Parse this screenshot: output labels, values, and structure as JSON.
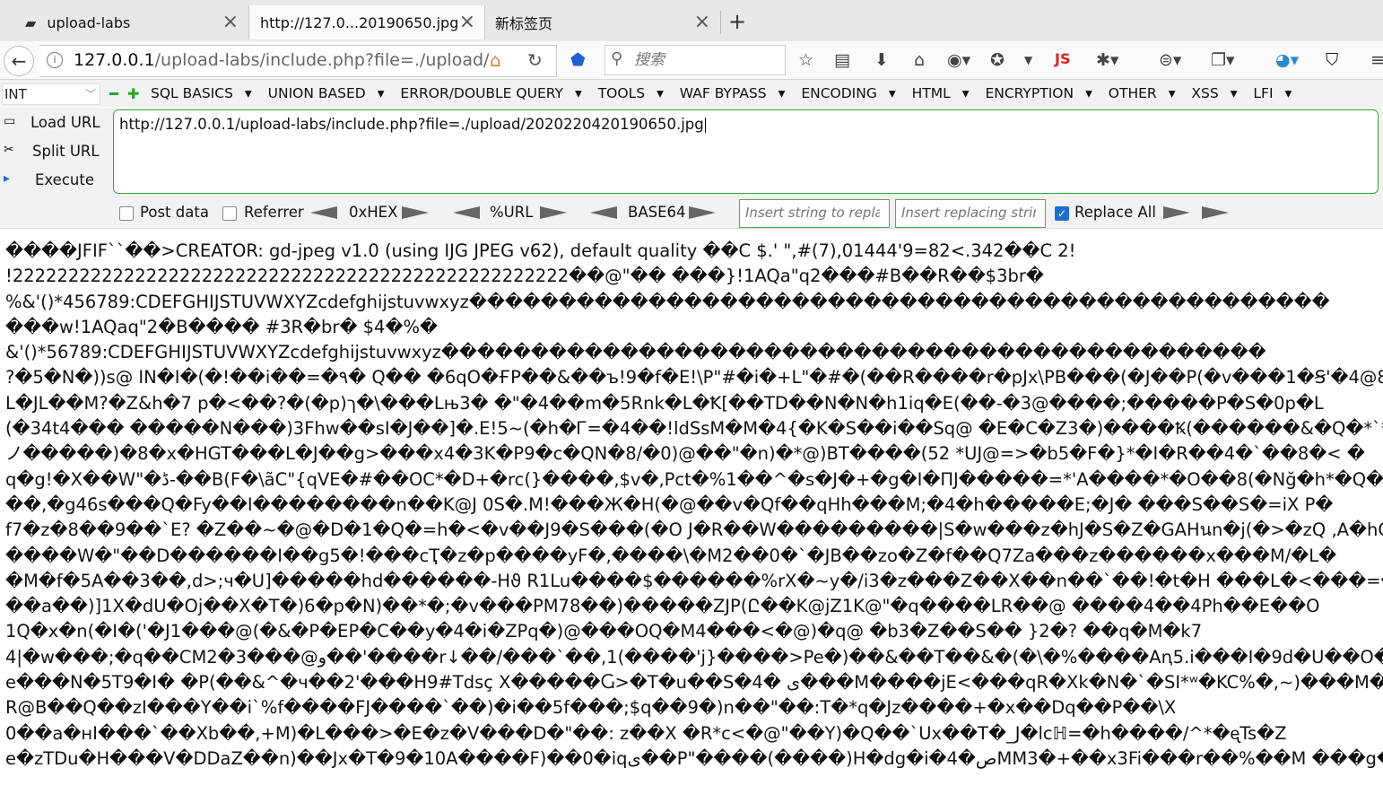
{
  "tabs": [
    {
      "label": "upload-labs"
    },
    {
      "label": "http://127.0...20190650.jpg"
    },
    {
      "label": "新标签页"
    }
  ],
  "nav": {
    "url_host": "127.0.0.1",
    "url_path": "/upload-labs/include.php?file=./upload/",
    "search_placeholder": "搜索",
    "js_label": "JS"
  },
  "hackbar": {
    "type_value": "INT",
    "menus": [
      "SQL BASICS",
      "UNION BASED",
      "ERROR/DOUBLE QUERY",
      "TOOLS",
      "WAF BYPASS",
      "ENCODING",
      "HTML",
      "ENCRYPTION",
      "OTHER",
      "XSS",
      "LFI"
    ],
    "load_url": "Load URL",
    "split_url": "Split URL",
    "execute": "Execute",
    "url_value": "http://127.0.0.1/upload-labs/include.php?file=./upload/2020220420190650.jpg",
    "post_data": "Post data",
    "referrer": "Referrer",
    "hex": "0xHEX",
    "urlenc": "%URL",
    "base64": "BASE64",
    "insert_placeholder": "Insert string to replace",
    "replacing_placeholder": "Insert replacing string",
    "replace_all": "Replace All"
  },
  "content_lines": [
    "����JFIF``��>CREATOR: gd-jpeg v1.0 (using IJG JPEG v62), default quality ��C    $.' \",#(7),01444'9=82<.342��C  2!",
    "!22222222222222222222222222222222222222222222222222��@\"�� ���}!1AQa\"q2���#B��R��$3br�",
    "%&'()*456789:CDEFGHIJSTUVWXYZcdefghijstuvwxyz������������������������������������������������",
    " ���w!1AQaq\"2�B���� #3R�br� $4�%�",
    "&'()*56789:CDEFGHIJSTUVWXYZcdefghijstuvwxyz����������������������������������������������",
    "?�5�N�))s@ IN�I�(�!��i��=�٩� Q�� �6qO�ҒP��&��ъ!9�f�E!\\P\"#�i�+L\"�#�(��R����r�pJx\\PB���(�J��P(�v���1�Ꞩ'�4@8�",
    "L�JL��M?�Z&h�7 p�<��?�(�p)ך�\\���Lњ3� �\"�4��m�5Rnk�L�Ꝁ[��TD��N�N�h1iq�E(��-�3@����;�����P�S�0p�L",
    "(�34t4��� �����N���)3Fhw��sI�J��]�.E!5~(�h�Ꮁ=�4��!ldSsM�M�4{�K�S��i��Sq@ �E�C�Z3�)����Ꝅ(������&�Q�*`*� Y",
    "ノ�����)�8�x�HGT���L�J��g>���x4�3K�P9�c�QN�8/�0)@��\"�n)�*@)BT����(52 *UJ@=>�b5�F�}*�I�R��4�`��8�< �",
    "q�g!�X��W\"�ڈ-��B(F�\\ãC\"{qVE�#��OC*�D+�rc(}����,$v�,Pct�%1��^�s�J�+�g�I�ПЈ�����=*'A����*�O��8(�Nğ�h*�Q�5 ��#",
    "��,�g46s���Q�Fy��I��������n��K@J 0S�.M!���Ж�H(�@��v�Qf��qHh���M;�4�h�����E;�J� ���S��S�=iX P�",
    "f7�z�8��9��`E? �Z��~�@�D�1�Q�=h�<�v��J9�S���(�O J�R��W���������|S�w���z�hJ�S�Z�GAHนn�j(�>�zQ ,A�hC",
    "����W�\"��D������I��g5�!���cҬ�z�p����yF�,����\\�M2��0�`�JB��zo�Z�f��Q7Za���z������x���M/�L�",
    "�M�f�5A��3��,d>;ч�U]�����hd������-Hϑ R1Lu����$������%rX�~y�/i3�z���Z��X��n��`��!�t�H ���L�<���=��",
    "��a��)]1X�dU�Oj��X�T�)6�p�N)��*�;�v���PM78��)�����ZJP(Ը��K@jZ1K@\"�q����LR��@ ����4��4Ph��E��O",
    "1Q�x�n(�I�('�J1���@(�&�P�EP�C��y�4�i�ZPq�)@���OQ�M4���<�@)�q@ �b3�Z��S�� }2�? ��q�M�k7",
    "4|�w���;�q��CM2�3���@ﻭ��'����r↓��/���`��,1(����'j}����>Pe�)��&��T��&�(�\\�%����Aꞑ5.i���I�9d�U��O� �P",
    "e���N�5T9�I� �P(��&^�ч��2'���H9#Tdsç X�����Ⴚ>�T�u��S�4� ﯼ���M����jE<���qR�Xk�N�`�SI*ʷ�KC%�,~)���M��",
    "R@B��Q��zI���Y��i`%f����FJ����`��)�i��5f���;$q��9�)n��\"��:T�*q�Jz����+�x��Dq��P��\\X",
    "0��a�нI���`��Xb��,+M)�L���>�E�z�V���D�\"��: z��X �R*c<�@\"��Y)�Q��`Ux��T�_J�lcℍ=�h����/^*�ᶒTs�Z",
    "e�zTDu�H���V�DDaZ��n)��Jx�T�9�10A����F)��0�iqﻯ��P\"����(����)H�dg�i�4�ﺹMM3�+��x3Fi���r��%��M ���g���"
  ]
}
